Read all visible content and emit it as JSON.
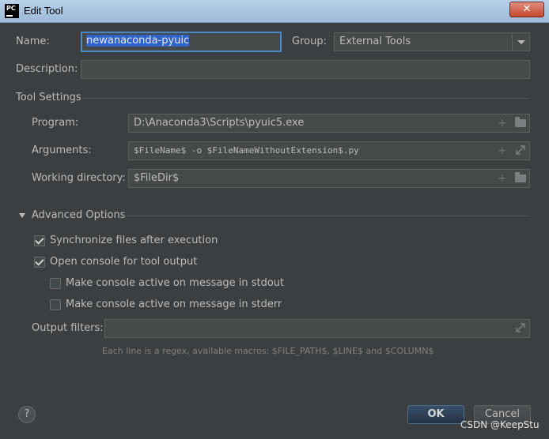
{
  "window": {
    "title": "Edit Tool",
    "app_icon_text": "PC",
    "close_symbol": "✕"
  },
  "form": {
    "name_label": "Name:",
    "name_value": "newanaconda-pyuic",
    "group_label": "Group:",
    "group_value": "External Tools",
    "description_label": "Description:",
    "description_value": ""
  },
  "tool_settings": {
    "header": "Tool Settings",
    "program_label": "Program:",
    "program_value": "D:\\Anaconda3\\Scripts\\pyuic5.exe",
    "arguments_label": "Arguments:",
    "arguments_value": "$FileName$ -o $FileNameWithoutExtension$.py",
    "working_dir_label": "Working directory:",
    "working_dir_value": "$FileDir$"
  },
  "advanced": {
    "header": "Advanced Options",
    "sync_label": "Synchronize files after execution",
    "sync_checked": true,
    "open_console_label": "Open console for tool output",
    "open_console_checked": true,
    "active_stdout_label": "Make console active on message in stdout",
    "active_stdout_checked": false,
    "active_stderr_label": "Make console active on message in stderr",
    "active_stderr_checked": false,
    "output_filters_label": "Output filters:",
    "output_filters_value": "",
    "hint": "Each line is a regex, available macros: $FILE_PATH$, $LINE$ and $COLUMN$"
  },
  "buttons": {
    "help": "?",
    "ok": "OK",
    "cancel": "Cancel",
    "plus": "+"
  },
  "watermark": "CSDN @KeepStu",
  "colors": {
    "background": "#3c3f41",
    "field": "#45494a",
    "focus": "#4a88c7",
    "selection": "#2f65ca"
  }
}
